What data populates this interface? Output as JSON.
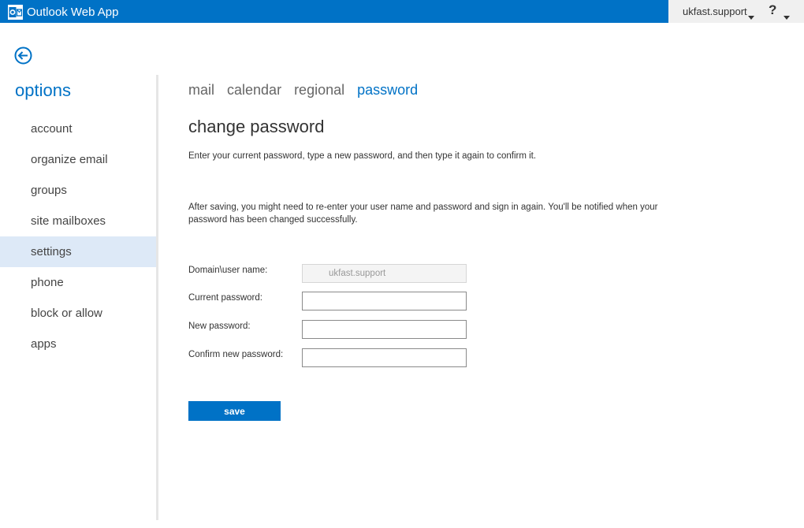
{
  "header": {
    "app_title": "Outlook Web App",
    "user_name": "ukfast.support",
    "help_label": "?"
  },
  "sidebar": {
    "title": "options",
    "items": [
      {
        "label": "account"
      },
      {
        "label": "organize email"
      },
      {
        "label": "groups"
      },
      {
        "label": "site mailboxes"
      },
      {
        "label": "settings",
        "selected": true
      },
      {
        "label": "phone"
      },
      {
        "label": "block or allow"
      },
      {
        "label": "apps"
      }
    ]
  },
  "tabs": [
    {
      "label": "mail"
    },
    {
      "label": "calendar"
    },
    {
      "label": "regional"
    },
    {
      "label": "password",
      "active": true
    }
  ],
  "main": {
    "title": "change password",
    "intro": "Enter your current password, type a new password, and then type it again to confirm it.",
    "note": "After saving, you might need to re-enter your user name and password and sign in again. You'll be notified when your password has been changed successfully.",
    "fields": {
      "domain_user": {
        "label": "Domain\\user name:",
        "value": "ukfast.support"
      },
      "current_password": {
        "label": "Current password:",
        "value": ""
      },
      "new_password": {
        "label": "New password:",
        "value": ""
      },
      "confirm_password": {
        "label": "Confirm new password:",
        "value": ""
      }
    },
    "save_label": "save"
  },
  "colors": {
    "accent": "#0072c6",
    "selected_nav_bg": "#dde9f7",
    "user_area_bg": "#f0f0f0"
  },
  "icons": {
    "app_logo": "outlook-logo-icon",
    "back": "back-arrow-icon",
    "caret": "chevron-down-icon",
    "help": "help-icon"
  }
}
